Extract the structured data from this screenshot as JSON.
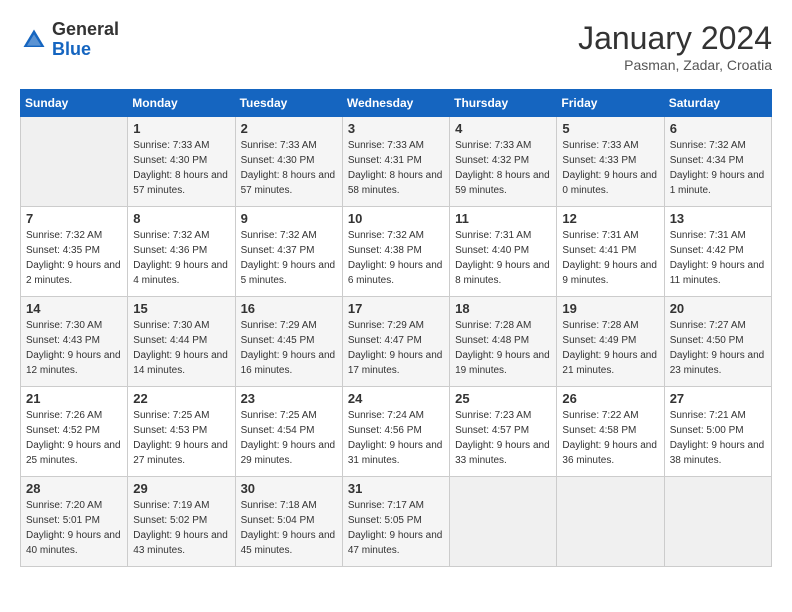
{
  "header": {
    "logo_general": "General",
    "logo_blue": "Blue",
    "month_year": "January 2024",
    "location": "Pasman, Zadar, Croatia"
  },
  "weekdays": [
    "Sunday",
    "Monday",
    "Tuesday",
    "Wednesday",
    "Thursday",
    "Friday",
    "Saturday"
  ],
  "weeks": [
    [
      {
        "day": "",
        "sunrise": "",
        "sunset": "",
        "daylight": ""
      },
      {
        "day": "1",
        "sunrise": "Sunrise: 7:33 AM",
        "sunset": "Sunset: 4:30 PM",
        "daylight": "Daylight: 8 hours and 57 minutes."
      },
      {
        "day": "2",
        "sunrise": "Sunrise: 7:33 AM",
        "sunset": "Sunset: 4:30 PM",
        "daylight": "Daylight: 8 hours and 57 minutes."
      },
      {
        "day": "3",
        "sunrise": "Sunrise: 7:33 AM",
        "sunset": "Sunset: 4:31 PM",
        "daylight": "Daylight: 8 hours and 58 minutes."
      },
      {
        "day": "4",
        "sunrise": "Sunrise: 7:33 AM",
        "sunset": "Sunset: 4:32 PM",
        "daylight": "Daylight: 8 hours and 59 minutes."
      },
      {
        "day": "5",
        "sunrise": "Sunrise: 7:33 AM",
        "sunset": "Sunset: 4:33 PM",
        "daylight": "Daylight: 9 hours and 0 minutes."
      },
      {
        "day": "6",
        "sunrise": "Sunrise: 7:32 AM",
        "sunset": "Sunset: 4:34 PM",
        "daylight": "Daylight: 9 hours and 1 minute."
      }
    ],
    [
      {
        "day": "7",
        "sunrise": "Sunrise: 7:32 AM",
        "sunset": "Sunset: 4:35 PM",
        "daylight": "Daylight: 9 hours and 2 minutes."
      },
      {
        "day": "8",
        "sunrise": "Sunrise: 7:32 AM",
        "sunset": "Sunset: 4:36 PM",
        "daylight": "Daylight: 9 hours and 4 minutes."
      },
      {
        "day": "9",
        "sunrise": "Sunrise: 7:32 AM",
        "sunset": "Sunset: 4:37 PM",
        "daylight": "Daylight: 9 hours and 5 minutes."
      },
      {
        "day": "10",
        "sunrise": "Sunrise: 7:32 AM",
        "sunset": "Sunset: 4:38 PM",
        "daylight": "Daylight: 9 hours and 6 minutes."
      },
      {
        "day": "11",
        "sunrise": "Sunrise: 7:31 AM",
        "sunset": "Sunset: 4:40 PM",
        "daylight": "Daylight: 9 hours and 8 minutes."
      },
      {
        "day": "12",
        "sunrise": "Sunrise: 7:31 AM",
        "sunset": "Sunset: 4:41 PM",
        "daylight": "Daylight: 9 hours and 9 minutes."
      },
      {
        "day": "13",
        "sunrise": "Sunrise: 7:31 AM",
        "sunset": "Sunset: 4:42 PM",
        "daylight": "Daylight: 9 hours and 11 minutes."
      }
    ],
    [
      {
        "day": "14",
        "sunrise": "Sunrise: 7:30 AM",
        "sunset": "Sunset: 4:43 PM",
        "daylight": "Daylight: 9 hours and 12 minutes."
      },
      {
        "day": "15",
        "sunrise": "Sunrise: 7:30 AM",
        "sunset": "Sunset: 4:44 PM",
        "daylight": "Daylight: 9 hours and 14 minutes."
      },
      {
        "day": "16",
        "sunrise": "Sunrise: 7:29 AM",
        "sunset": "Sunset: 4:45 PM",
        "daylight": "Daylight: 9 hours and 16 minutes."
      },
      {
        "day": "17",
        "sunrise": "Sunrise: 7:29 AM",
        "sunset": "Sunset: 4:47 PM",
        "daylight": "Daylight: 9 hours and 17 minutes."
      },
      {
        "day": "18",
        "sunrise": "Sunrise: 7:28 AM",
        "sunset": "Sunset: 4:48 PM",
        "daylight": "Daylight: 9 hours and 19 minutes."
      },
      {
        "day": "19",
        "sunrise": "Sunrise: 7:28 AM",
        "sunset": "Sunset: 4:49 PM",
        "daylight": "Daylight: 9 hours and 21 minutes."
      },
      {
        "day": "20",
        "sunrise": "Sunrise: 7:27 AM",
        "sunset": "Sunset: 4:50 PM",
        "daylight": "Daylight: 9 hours and 23 minutes."
      }
    ],
    [
      {
        "day": "21",
        "sunrise": "Sunrise: 7:26 AM",
        "sunset": "Sunset: 4:52 PM",
        "daylight": "Daylight: 9 hours and 25 minutes."
      },
      {
        "day": "22",
        "sunrise": "Sunrise: 7:25 AM",
        "sunset": "Sunset: 4:53 PM",
        "daylight": "Daylight: 9 hours and 27 minutes."
      },
      {
        "day": "23",
        "sunrise": "Sunrise: 7:25 AM",
        "sunset": "Sunset: 4:54 PM",
        "daylight": "Daylight: 9 hours and 29 minutes."
      },
      {
        "day": "24",
        "sunrise": "Sunrise: 7:24 AM",
        "sunset": "Sunset: 4:56 PM",
        "daylight": "Daylight: 9 hours and 31 minutes."
      },
      {
        "day": "25",
        "sunrise": "Sunrise: 7:23 AM",
        "sunset": "Sunset: 4:57 PM",
        "daylight": "Daylight: 9 hours and 33 minutes."
      },
      {
        "day": "26",
        "sunrise": "Sunrise: 7:22 AM",
        "sunset": "Sunset: 4:58 PM",
        "daylight": "Daylight: 9 hours and 36 minutes."
      },
      {
        "day": "27",
        "sunrise": "Sunrise: 7:21 AM",
        "sunset": "Sunset: 5:00 PM",
        "daylight": "Daylight: 9 hours and 38 minutes."
      }
    ],
    [
      {
        "day": "28",
        "sunrise": "Sunrise: 7:20 AM",
        "sunset": "Sunset: 5:01 PM",
        "daylight": "Daylight: 9 hours and 40 minutes."
      },
      {
        "day": "29",
        "sunrise": "Sunrise: 7:19 AM",
        "sunset": "Sunset: 5:02 PM",
        "daylight": "Daylight: 9 hours and 43 minutes."
      },
      {
        "day": "30",
        "sunrise": "Sunrise: 7:18 AM",
        "sunset": "Sunset: 5:04 PM",
        "daylight": "Daylight: 9 hours and 45 minutes."
      },
      {
        "day": "31",
        "sunrise": "Sunrise: 7:17 AM",
        "sunset": "Sunset: 5:05 PM",
        "daylight": "Daylight: 9 hours and 47 minutes."
      },
      {
        "day": "",
        "sunrise": "",
        "sunset": "",
        "daylight": ""
      },
      {
        "day": "",
        "sunrise": "",
        "sunset": "",
        "daylight": ""
      },
      {
        "day": "",
        "sunrise": "",
        "sunset": "",
        "daylight": ""
      }
    ]
  ]
}
